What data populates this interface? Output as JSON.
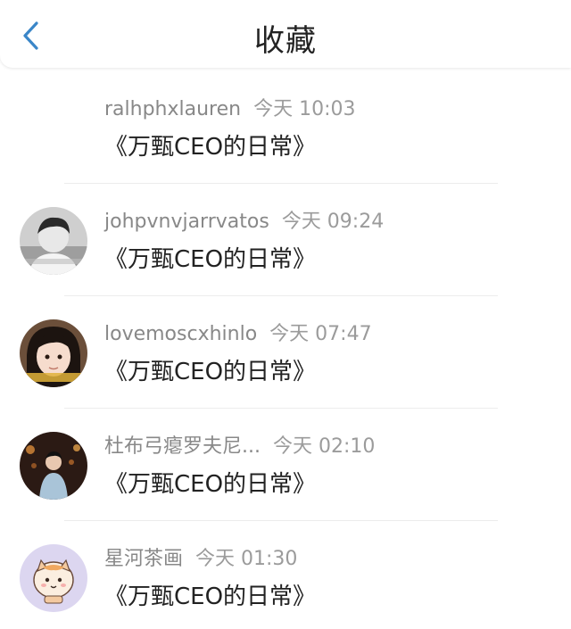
{
  "header": {
    "title": "收藏"
  },
  "colors": {
    "accent": "#3a86c8",
    "title_text": "#222222",
    "meta_text": "#888888",
    "divider": "#ececec"
  },
  "items": [
    {
      "username": "ralhphxlauren",
      "time": "今天 10:03",
      "content": "《万甄CEO的日常》",
      "avatar": "none"
    },
    {
      "username": "johpvnvjarrvatos",
      "time": "今天 09:24",
      "content": "《万甄CEO的日常》",
      "avatar": "photo-grayscale"
    },
    {
      "username": "lovemoscxhinlo",
      "time": "今天 07:47",
      "content": "《万甄CEO的日常》",
      "avatar": "photo-girl"
    },
    {
      "username": "杜布弓瘪罗夫尼...",
      "time": "今天 02:10",
      "content": "《万甄CEO的日常》",
      "avatar": "photo-night"
    },
    {
      "username": "星河茶画",
      "time": "今天 01:30",
      "content": "《万甄CEO的日常》",
      "avatar": "cartoon-cat"
    }
  ]
}
